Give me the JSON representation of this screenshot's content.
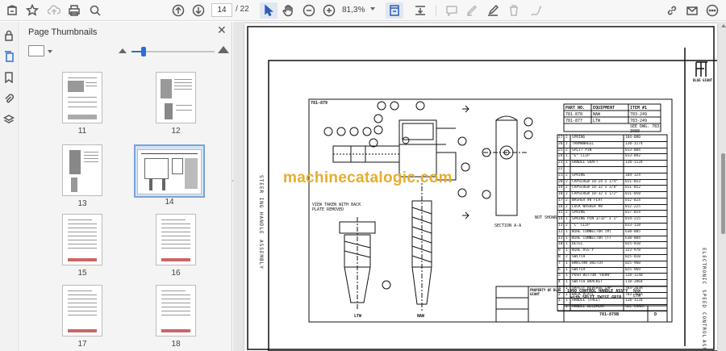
{
  "toolbar": {
    "current_page": "14",
    "page_total": "/ 22",
    "zoom": "81,3%",
    "icons": [
      "home-icon",
      "bookmark-star-icon",
      "cloud-upload-icon",
      "print-icon",
      "zoom-search-icon",
      "page-up-icon",
      "page-down-icon",
      "select-cursor-icon",
      "hand-icon",
      "zoom-out-icon",
      "zoom-in-icon",
      "fit-page-icon",
      "scroll-mode-icon",
      "comment-icon",
      "highlight-icon",
      "sign-icon",
      "delete-icon",
      "link-icon",
      "email-icon",
      "more-icon"
    ]
  },
  "panel": {
    "title": "Page Thumbnails",
    "close": "✕",
    "thumb_size_percent": 15,
    "thumbnails": [
      {
        "num": "11"
      },
      {
        "num": "12"
      },
      {
        "num": "13"
      },
      {
        "num": "14"
      },
      {
        "num": "15"
      },
      {
        "num": "16"
      },
      {
        "num": "17"
      },
      {
        "num": "18"
      }
    ],
    "selected_page": "14"
  },
  "document": {
    "watermark": "machinecatalogic.com",
    "side_left_a": "STEER ING",
    "side_left_b": "HANDLE",
    "side_left_c": "ASSEMBLY",
    "side_right_a": "ELECTRONIC",
    "side_right_b": "SPEED",
    "side_right_c": "CONTROL",
    "side_right_d": "ASS",
    "doc_number_top": "781-879",
    "view_note": "VIEW TAKEN WITH BACK PLATE REMOVED",
    "section_label": "SECTION A-A",
    "not_shown": "NOT SHOWN",
    "label_ltw": "LTW",
    "label_naw": "NAW",
    "part_table_header": [
      "PART NO.",
      "EQUIPMENT",
      "ITEM #1"
    ],
    "part_table_rows": [
      [
        "781-878",
        "NAW",
        "783-249"
      ],
      [
        "781-877",
        "LTW",
        "783-249"
      ]
    ],
    "see_dwg": "SEE DWG. 783-3088",
    "parts": [
      [
        "27",
        "2",
        "SPRING",
        "104-080"
      ],
      [
        "26",
        "1",
        "THUMBWHEEL",
        "120-1174"
      ],
      [
        "25",
        "2",
        "SPLIT PIN",
        "013-004"
      ],
      [
        "24",
        "1",
        "\"E\" CLIP",
        "013-092"
      ],
      [
        "23",
        "1",
        "HANDLE SHAFT",
        "120-1134"
      ],
      [
        "22",
        "",
        "",
        ""
      ],
      [
        "21",
        "2",
        "SPRING",
        "104-124"
      ],
      [
        "20",
        "2",
        "CAPSCREW 10-24 x 1/4\"",
        "011-053"
      ],
      [
        "19",
        "2",
        "CAPSCREW 10-32 x 3/8\"",
        "011-052"
      ],
      [
        "18",
        "2",
        "CAPSCREW 10-32 x 1/2\"",
        "011-058"
      ],
      [
        "17",
        "2",
        "WASHER #8 FLAT",
        "012-024"
      ],
      [
        "16",
        "2",
        "LOCK WASHER #8",
        "012-225"
      ],
      [
        "15",
        "2",
        "SPRING",
        "017-054"
      ],
      [
        "14",
        "1",
        "SPRING PIN 3/32\" x 1\"",
        "014-215"
      ],
      [
        "13",
        "2",
        "\"C\" CLIP",
        "013-118"
      ],
      [
        "12",
        "1",
        "WIRE CONNECTOR (M)",
        "630-085"
      ],
      [
        "11",
        "1",
        "WIRE CONNECTOR (F)",
        "630-084"
      ],
      [
        "10",
        "1",
        "DETEL",
        "025-810"
      ],
      [
        "9",
        "1",
        "WIRE ASS'Y",
        "323-978"
      ],
      [
        "8",
        "2",
        "SWITCH",
        "025-810"
      ],
      [
        "7",
        "1",
        "BRKSTRN SWITCH",
        "025-960"
      ],
      [
        "6",
        "1",
        "SWITCH",
        "025-969"
      ],
      [
        "5",
        "1",
        "PUSH BUTTON \"HORN\"",
        "120-1148"
      ],
      [
        "4",
        "1",
        "SWITCH BRACKET",
        "118-2864"
      ],
      [
        "3",
        "1",
        "SAFETY REVERSE CAP",
        "783-263A"
      ],
      [
        "2",
        "1",
        "BACK PLATE",
        "783-251A"
      ],
      [
        "1",
        "1",
        "HANDLE (FREE)",
        "120-1134"
      ],
      [
        "",
        "1",
        "HANDLE WELDMENT",
        "SEE CHART"
      ]
    ],
    "title_block": {
      "property": "PROPERTY OF BLUE GIANT",
      "title_line1": "1990 CONTROL HANDLE ASS'Y",
      "title_line2": "with SPLIT TWIST GRIP",
      "models": "NAW LTW",
      "drawing_number": "781-879B",
      "rev": "D"
    },
    "brand": "BLUE GIANT"
  }
}
